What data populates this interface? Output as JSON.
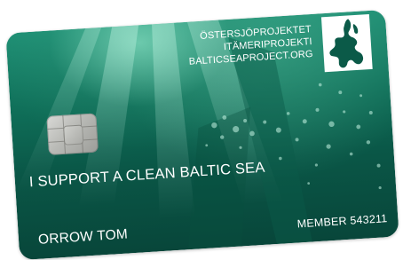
{
  "card": {
    "organization_lines": [
      "ÖSTERSJÖPROJEKTET",
      "ITÄMERIPROJEKTI",
      "BALTICSEAPROJECT.ORG"
    ],
    "slogan": "I SUPPORT A CLEAN BALTIC SEA",
    "holder_name": "ORROW TOM",
    "member_label": "MEMBER 543211",
    "logo_icon": "baltic-sea-map-icon",
    "chip_icon": "emv-chip-icon",
    "colors": {
      "card_top": "#1e8f74",
      "card_bottom": "#08463a",
      "text": "#ffffff",
      "logo_background": "#ffffff",
      "logo_map": "#0b5a48"
    }
  }
}
